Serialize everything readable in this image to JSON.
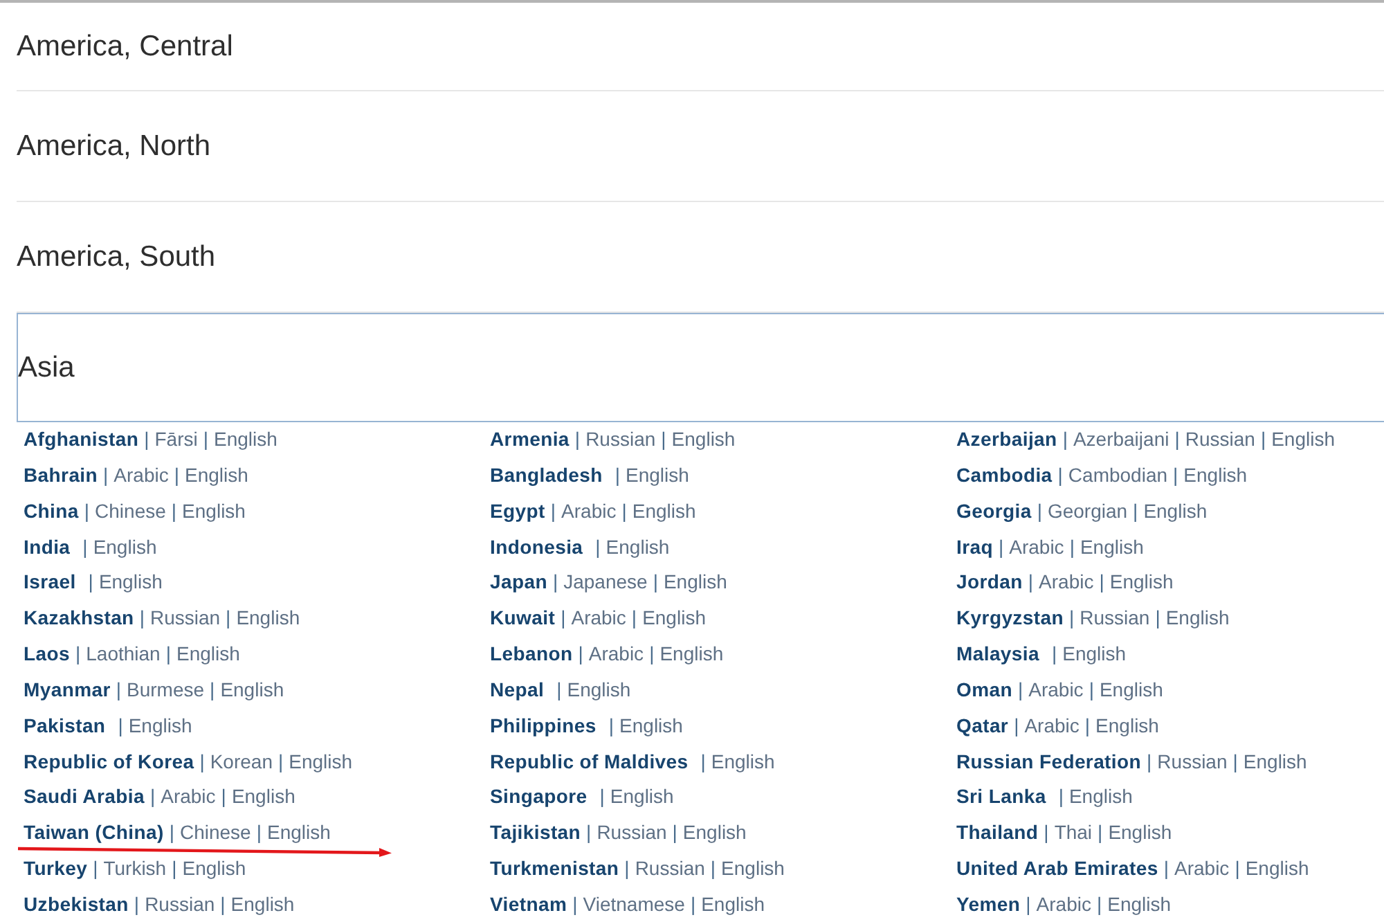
{
  "separator": "|",
  "regions": [
    {
      "name": "America, Central",
      "expanded": false
    },
    {
      "name": "America, North",
      "expanded": false
    },
    {
      "name": "America, South",
      "expanded": false
    },
    {
      "name": "Asia",
      "expanded": true,
      "countries": [
        {
          "name": "Afghanistan",
          "languages": [
            "Fārsi",
            "English"
          ],
          "annotated": false
        },
        {
          "name": "Armenia",
          "languages": [
            "Russian",
            "English"
          ],
          "annotated": false
        },
        {
          "name": "Azerbaijan",
          "languages": [
            "Azerbaijani",
            "Russian",
            "English"
          ],
          "annotated": false
        },
        {
          "name": "Bahrain",
          "languages": [
            "Arabic",
            "English"
          ],
          "annotated": false
        },
        {
          "name": "Bangladesh",
          "languages": [
            "English"
          ],
          "annotated": false
        },
        {
          "name": "Cambodia",
          "languages": [
            "Cambodian",
            "English"
          ],
          "annotated": false
        },
        {
          "name": "China",
          "languages": [
            "Chinese",
            "English"
          ],
          "annotated": false
        },
        {
          "name": "Egypt",
          "languages": [
            "Arabic",
            "English"
          ],
          "annotated": false
        },
        {
          "name": "Georgia",
          "languages": [
            "Georgian",
            "English"
          ],
          "annotated": false
        },
        {
          "name": "India",
          "languages": [
            "English"
          ],
          "annotated": false
        },
        {
          "name": "Indonesia",
          "languages": [
            "English"
          ],
          "annotated": false
        },
        {
          "name": "Iraq",
          "languages": [
            "Arabic",
            "English"
          ],
          "annotated": false
        },
        {
          "name": "Israel",
          "languages": [
            "English"
          ],
          "annotated": false
        },
        {
          "name": "Japan",
          "languages": [
            "Japanese",
            "English"
          ],
          "annotated": false
        },
        {
          "name": "Jordan",
          "languages": [
            "Arabic",
            "English"
          ],
          "annotated": false
        },
        {
          "name": "Kazakhstan",
          "languages": [
            "Russian",
            "English"
          ],
          "annotated": false
        },
        {
          "name": "Kuwait",
          "languages": [
            "Arabic",
            "English"
          ],
          "annotated": false
        },
        {
          "name": "Kyrgyzstan",
          "languages": [
            "Russian",
            "English"
          ],
          "annotated": false
        },
        {
          "name": "Laos",
          "languages": [
            "Laothian",
            "English"
          ],
          "annotated": false
        },
        {
          "name": "Lebanon",
          "languages": [
            "Arabic",
            "English"
          ],
          "annotated": false
        },
        {
          "name": "Malaysia",
          "languages": [
            "English"
          ],
          "annotated": false
        },
        {
          "name": "Myanmar",
          "languages": [
            "Burmese",
            "English"
          ],
          "annotated": false
        },
        {
          "name": "Nepal",
          "languages": [
            "English"
          ],
          "annotated": false
        },
        {
          "name": "Oman",
          "languages": [
            "Arabic",
            "English"
          ],
          "annotated": false
        },
        {
          "name": "Pakistan",
          "languages": [
            "English"
          ],
          "annotated": false
        },
        {
          "name": "Philippines",
          "languages": [
            "English"
          ],
          "annotated": false
        },
        {
          "name": "Qatar",
          "languages": [
            "Arabic",
            "English"
          ],
          "annotated": false
        },
        {
          "name": "Republic of Korea",
          "languages": [
            "Korean",
            "English"
          ],
          "annotated": false
        },
        {
          "name": "Republic of Maldives",
          "languages": [
            "English"
          ],
          "annotated": false
        },
        {
          "name": "Russian Federation",
          "languages": [
            "Russian",
            "English"
          ],
          "annotated": false
        },
        {
          "name": "Saudi Arabia",
          "languages": [
            "Arabic",
            "English"
          ],
          "annotated": false
        },
        {
          "name": "Singapore",
          "languages": [
            "English"
          ],
          "annotated": false
        },
        {
          "name": "Sri Lanka",
          "languages": [
            "English"
          ],
          "annotated": false
        },
        {
          "name": "Taiwan (China)",
          "languages": [
            "Chinese",
            "English"
          ],
          "annotated": true
        },
        {
          "name": "Tajikistan",
          "languages": [
            "Russian",
            "English"
          ],
          "annotated": false
        },
        {
          "name": "Thailand",
          "languages": [
            "Thai",
            "English"
          ],
          "annotated": false
        },
        {
          "name": "Turkey",
          "languages": [
            "Turkish",
            "English"
          ],
          "annotated": false
        },
        {
          "name": "Turkmenistan",
          "languages": [
            "Russian",
            "English"
          ],
          "annotated": false
        },
        {
          "name": "United Arab Emirates",
          "languages": [
            "Arabic",
            "English"
          ],
          "annotated": false
        },
        {
          "name": "Uzbekistan",
          "languages": [
            "Russian",
            "English"
          ],
          "annotated": false
        },
        {
          "name": "Vietnam",
          "languages": [
            "Vietnamese",
            "English"
          ],
          "annotated": false
        },
        {
          "name": "Yemen",
          "languages": [
            "Arabic",
            "English"
          ],
          "annotated": false
        }
      ]
    }
  ]
}
